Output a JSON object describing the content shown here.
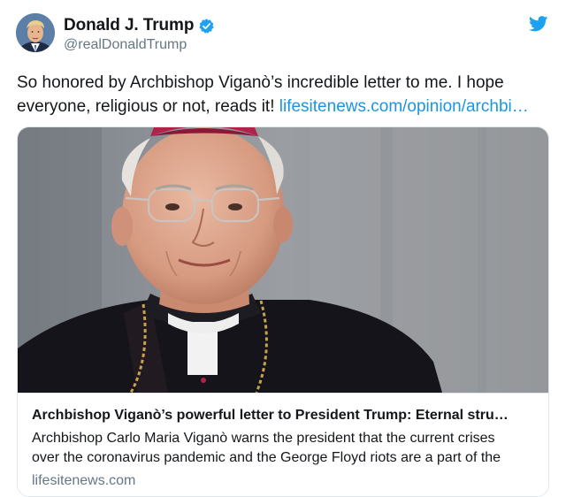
{
  "author": {
    "display_name": "Donald J. Trump",
    "handle": "@realDonaldTrump",
    "avatar_icon": "profile-photo",
    "verified_icon": "verified-badge-icon"
  },
  "tweet": {
    "text": "So honored by Archbishop Viganò’s incredible letter to me. I hope everyone, religious or not, reads it! ",
    "link": "lifesitenews.com/opinion/archbi…"
  },
  "card": {
    "image_icon": "archbishop-photo",
    "title": "Archbishop Viganò’s powerful letter to President Trump: Eternal stru…",
    "description_line1": "Archbishop Carlo Maria Viganò warns the president that the current crises",
    "description_line2": "over the coronavirus pandemic and the George Floyd riots are a part of the",
    "domain": "lifesitenews.com"
  },
  "colors": {
    "link": "#1b95e0",
    "twitter_blue": "#1da1f2",
    "secondary_text": "#657786",
    "border": "#e1e8ed"
  }
}
